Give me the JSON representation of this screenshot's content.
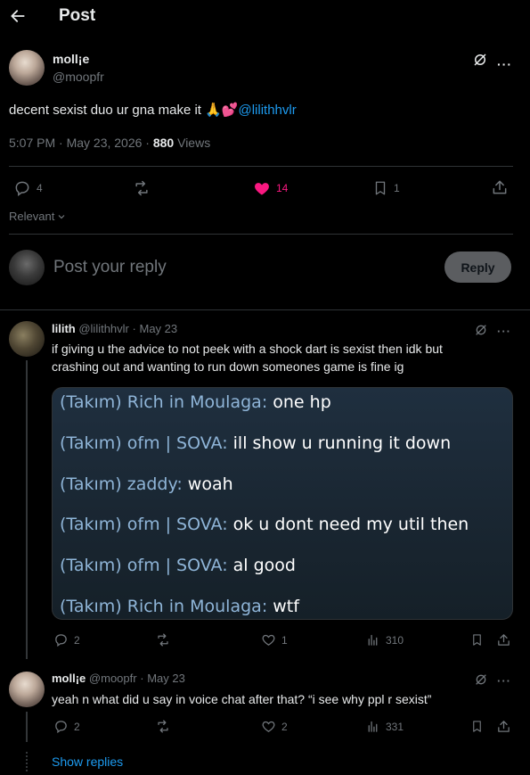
{
  "header": {
    "title": "Post"
  },
  "post": {
    "author_name": "moll¡e",
    "author_handle": "@moopfr",
    "text": "decent sexist duo ur gna make it 🙏💕",
    "mention": "@lilithhvlr",
    "time": "5:07 PM · May 23, 2026 · ",
    "views_count": "880",
    "views_label": " Views",
    "replies": "4",
    "likes": "14",
    "bookmarks": "1"
  },
  "sort": {
    "label": "Relevant"
  },
  "reply_box": {
    "placeholder": "Post your reply",
    "button": "Reply"
  },
  "replies": [
    {
      "author_name": "lilith",
      "author_handle": "@lilithhvlr",
      "date": "May 23",
      "text": "if giving u the advice to not peek with a shock dart is sexist then idk but crashing out and wanting to run down someones game is fine ig",
      "chat": [
        {
          "team": "(Takım) Rich in Moulaga:",
          "msg": " one hp"
        },
        {
          "team": "(Takım) ofm | SOVA:",
          "msg": " ill show u running it down"
        },
        {
          "team": "(Takım) zaddy:",
          "msg": " woah"
        },
        {
          "team": "(Takım) ofm | SOVA:",
          "msg": " ok u dont need my util then"
        },
        {
          "team": "(Takım) ofm | SOVA:",
          "msg": " al good"
        },
        {
          "team": "(Takım) Rich in Moulaga:",
          "msg": " wtf"
        }
      ],
      "replies": "2",
      "likes": "1",
      "views": "310"
    },
    {
      "author_name": "moll¡e",
      "author_handle": "@moopfr",
      "date": "May 23",
      "text": "yeah n what did u say in voice chat after that? “i see why ppl r sexist”",
      "replies": "2",
      "likes": "2",
      "views": "331"
    }
  ],
  "show_replies": "Show replies",
  "colors": {
    "accent": "#1d9bf0",
    "like": "#f91880",
    "muted": "#71767b"
  }
}
